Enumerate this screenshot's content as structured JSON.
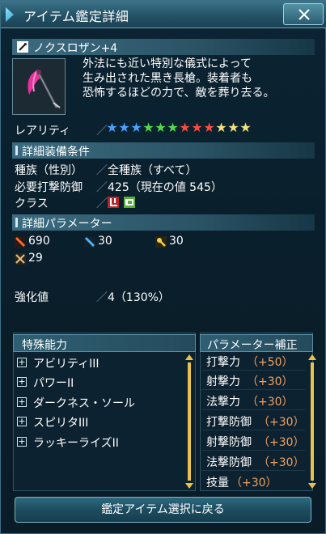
{
  "window": {
    "title": "アイテム鑑定詳細",
    "close_icon": "close-x-icon"
  },
  "item": {
    "name": "ノクスロザン+4",
    "description": [
      "外法にも近い特別な儀式によって",
      "生み出された黒き長槍。装着者も",
      "恐怖するほどの力で、敵を葬り去る。"
    ]
  },
  "rarity": {
    "label": "レアリティ",
    "separator": "／",
    "stars": [
      {
        "glyph": "★",
        "color": "#4aa0ff"
      },
      {
        "glyph": "★",
        "color": "#4aa0ff"
      },
      {
        "glyph": "★",
        "color": "#4aa0ff"
      },
      {
        "glyph": "★",
        "color": "#55d84a"
      },
      {
        "glyph": "★",
        "color": "#55d84a"
      },
      {
        "glyph": "★",
        "color": "#55d84a"
      },
      {
        "glyph": "★",
        "color": "#ff4a3a"
      },
      {
        "glyph": "★",
        "color": "#ff4a3a"
      },
      {
        "glyph": "★",
        "color": "#ff4a3a"
      },
      {
        "glyph": "★",
        "color": "#f3e27a"
      },
      {
        "glyph": "★",
        "color": "#f3e27a"
      },
      {
        "glyph": "★",
        "color": "#f3e27a"
      }
    ]
  },
  "requirements": {
    "header": "詳細装備条件",
    "race_label": "種族（性別）",
    "race_value": "全種族（すべて）",
    "defense_label": "必要打撃防御",
    "defense_value": "425（現在の値 545）",
    "class_label": "クラス",
    "separator": "／"
  },
  "parameters": {
    "header": "詳細パラメーター",
    "strike_atk": "690",
    "range_atk": "30",
    "tech_atk": "30",
    "dexterity": "29"
  },
  "enhancement": {
    "label": "強化値",
    "separator": "／",
    "value": "4（130%）"
  },
  "special_abilities": {
    "header": "特殊能力",
    "expand_glyph": "+",
    "items": [
      "アビリティIII",
      "パワーII",
      "ダークネス・ソール",
      "スピリタIII",
      "ラッキーライズII"
    ]
  },
  "param_bonus": {
    "header": "パラメーター補正",
    "rows": [
      {
        "name": "打撃力",
        "bonus": "（+50）"
      },
      {
        "name": "射撃力",
        "bonus": "（+30）"
      },
      {
        "name": "法撃力",
        "bonus": "（+30）"
      },
      {
        "name": "打撃防御",
        "bonus": "（+30）"
      },
      {
        "name": "射撃防御",
        "bonus": "（+30）"
      },
      {
        "name": "法撃防御",
        "bonus": "（+30）"
      },
      {
        "name": "技量",
        "bonus": "（+30）"
      }
    ]
  },
  "footer": {
    "return_button": "鑑定アイテム選択に戻る"
  },
  "colors": {
    "accent": "#3c7488",
    "bonus": "#f0a160",
    "scroll": "#e8c24a"
  }
}
